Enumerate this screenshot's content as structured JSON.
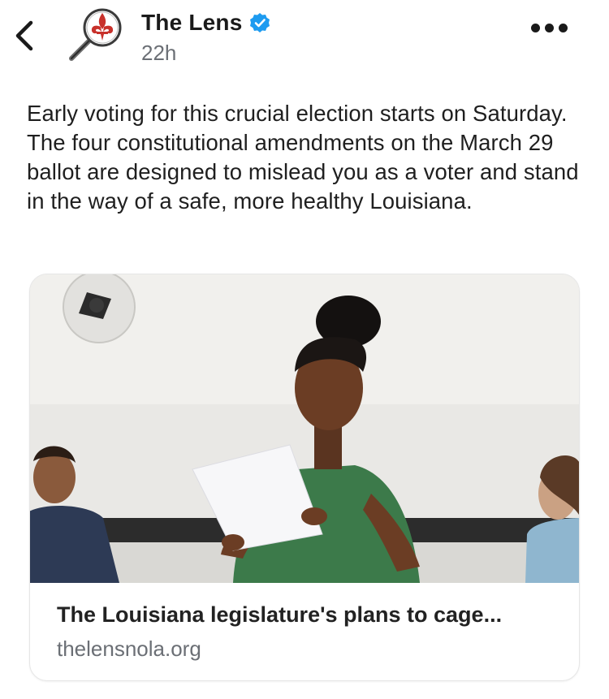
{
  "header": {
    "account_name": "The Lens",
    "timestamp": "22h",
    "verified": true,
    "accent_color": "#1d9bf0",
    "back_icon": "chevron-left-icon",
    "more_icon": "more-horizontal-icon",
    "avatar_icon": "fleur-de-lis-magnifier-logo"
  },
  "post": {
    "text": "Early voting for this crucial election starts on Saturday. The four constitutional amendments on the March 29 ballot are designed to mislead you as a voter and stand in the way of a safe, more healthy Louisiana."
  },
  "link_card": {
    "title": "The Louisiana legislature's plans to cage...",
    "domain": "thelensnola.org",
    "image_description_icon": "article-thumbnail-image"
  }
}
